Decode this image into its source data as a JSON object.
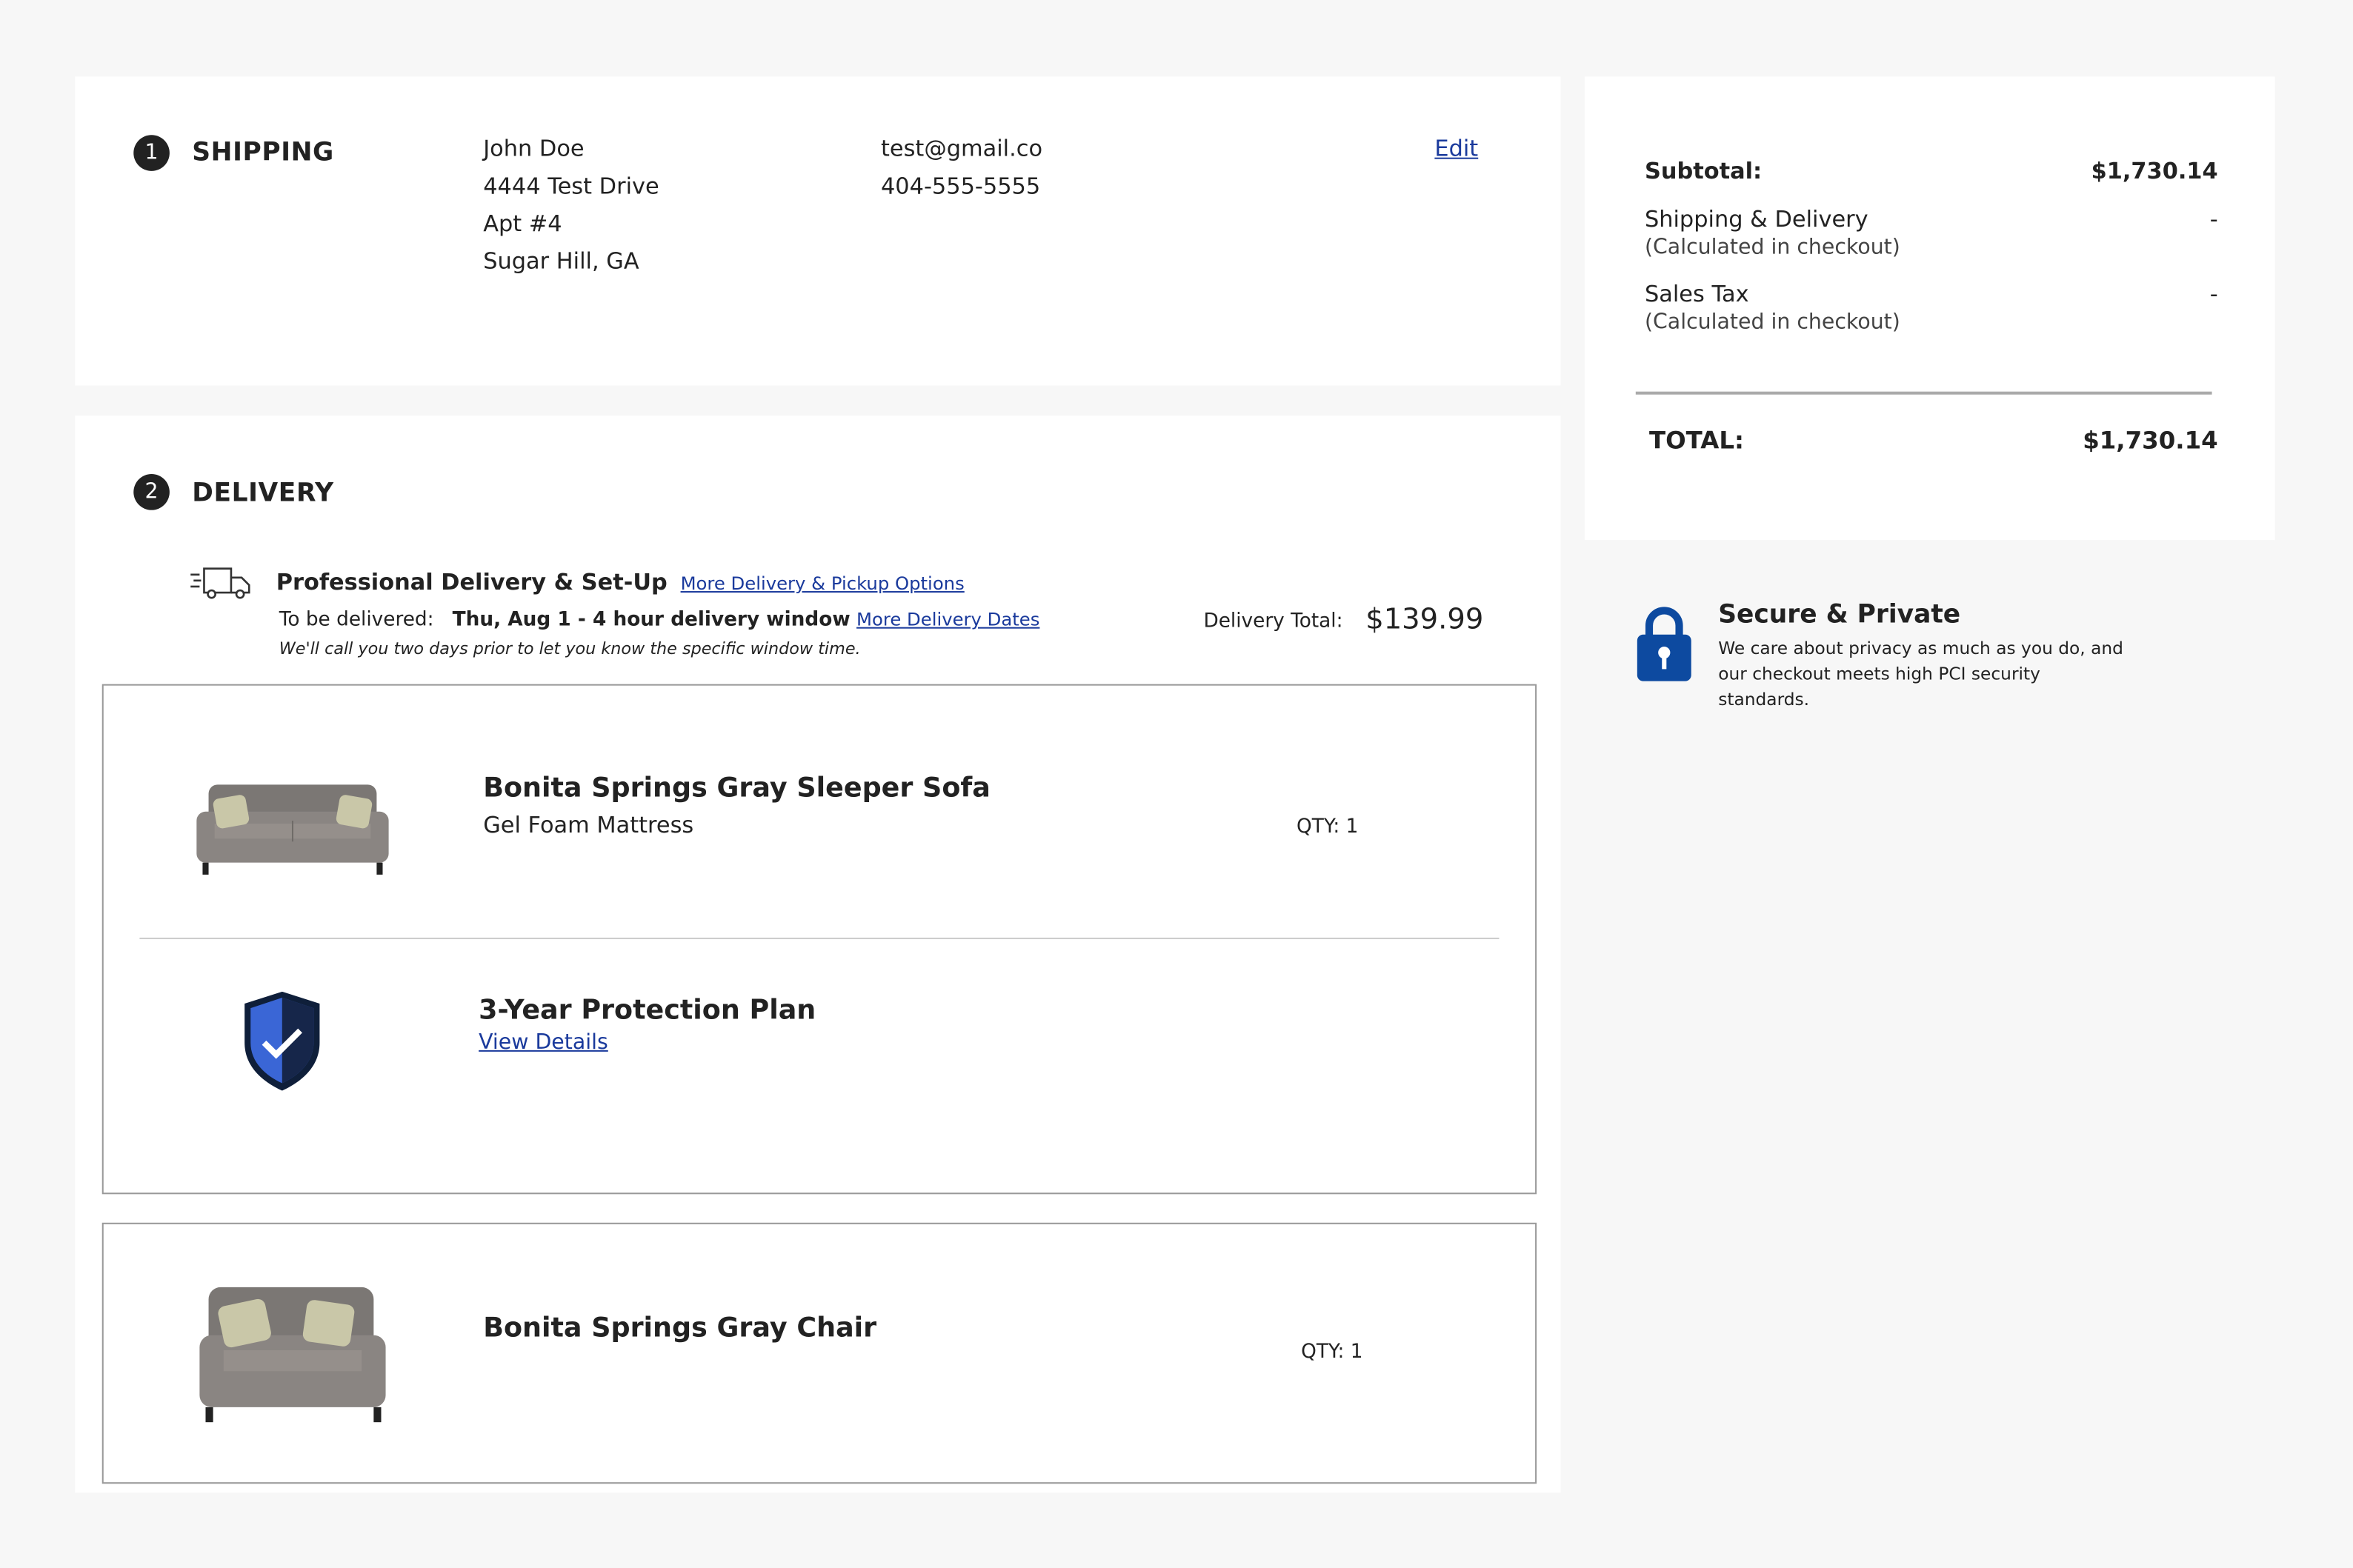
{
  "shipping": {
    "step": "1",
    "title": "SHIPPING",
    "name": "John Doe",
    "address1": "4444 Test Drive",
    "address2": "Apt #4",
    "city": "Sugar Hill, GA",
    "email": "test@gmail.co",
    "phone": "404-555-5555",
    "edit_label": "Edit"
  },
  "delivery": {
    "step": "2",
    "title": "DELIVERY",
    "method": "Professional Delivery & Set-Up",
    "more_options_link": "More Delivery & Pickup Options",
    "to_be_delivered_label": "To be delivered:",
    "date_window": "Thu, Aug 1 - 4 hour delivery window",
    "more_dates_link": "More Delivery Dates",
    "note": "We'll call you two days prior to let you know the specific window time.",
    "total_label": "Delivery Total:",
    "total_value": "$139.99",
    "items": [
      {
        "name": "Bonita Springs Gray Sleeper Sofa",
        "option": "Gel Foam Mattress",
        "qty": "QTY: 1"
      },
      {
        "name": "Bonita Springs Gray Chair",
        "qty": "QTY: 1"
      }
    ],
    "protection": {
      "name": "3-Year Protection Plan",
      "link": "View Details"
    }
  },
  "summary": {
    "subtotal_label": "Subtotal:",
    "subtotal_value": "$1,730.14",
    "shipping_label": "Shipping & Delivery",
    "shipping_note": "(Calculated in checkout)",
    "shipping_value": "-",
    "tax_label": "Sales Tax",
    "tax_note": "(Calculated in checkout)",
    "tax_value": "-",
    "total_label": "TOTAL:",
    "total_value": "$1,730.14"
  },
  "secure": {
    "title": "Secure & Private",
    "text": "We care about privacy as much as you do, and our checkout meets high PCI security standards."
  },
  "colors": {
    "link": "#1a3a9c",
    "lock": "#0d4aa0",
    "shield": "#2f5fce"
  }
}
